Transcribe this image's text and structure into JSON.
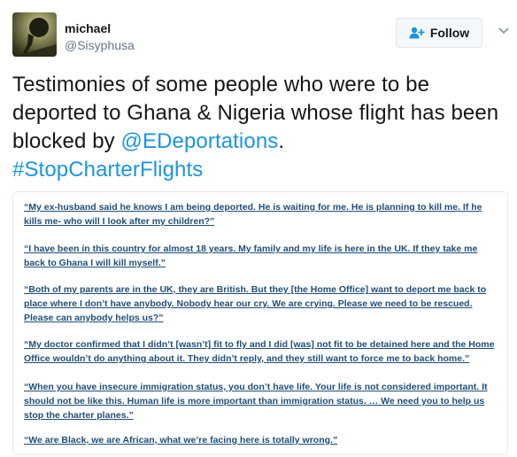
{
  "user": {
    "name": "michael",
    "handle": "@Sisyphusa",
    "avatar_icon": "sisyphus-boulder-avatar"
  },
  "follow": {
    "label": "Follow",
    "icon": "add-user-icon"
  },
  "more_icon": "chevron-down-icon",
  "tweet": {
    "text_start": "Testimonies of some people who were to be deported to Ghana & Nigeria whose flight has been blocked by ",
    "mention": "@EDeportations",
    "after_mention": ".",
    "hashtag": "#StopCharterFlights"
  },
  "quotes": [
    "“My ex-husband said he knows I am being deported. He is waiting for me. He is planning to kill me. If he kills me- who will I look after my children?”",
    "“I have been in this country for almost 18 years. My family and my life is here in the UK. If they take me back to Ghana I will kill myself.”",
    "“Both of my parents are in the UK, they are British. But they [the Home Office] want to deport me back to place where I don’t have anybody. Nobody hear our cry. We are crying. Please we need to be rescued. Please can anybody helps us?”",
    "“My doctor confirmed that I didn’t [wasn’t] fit to fly and I did [was] not fit to be detained here and the Home Office wouldn’t do anything about it. They didn’t reply, and they still want to force me to back home.”",
    "“When you have insecure immigration status, you don’t have life. Your life is not considered important. It should not be like this. Human life is more important than immigration status. … We need you to help us stop the charter planes.”",
    "“We are Black, we are African, what we’re facing here is totally wrong.”"
  ],
  "colors": {
    "link": "#1b95e0",
    "quote_text": "#1f4e79",
    "text": "#14171a",
    "muted": "#657786"
  }
}
